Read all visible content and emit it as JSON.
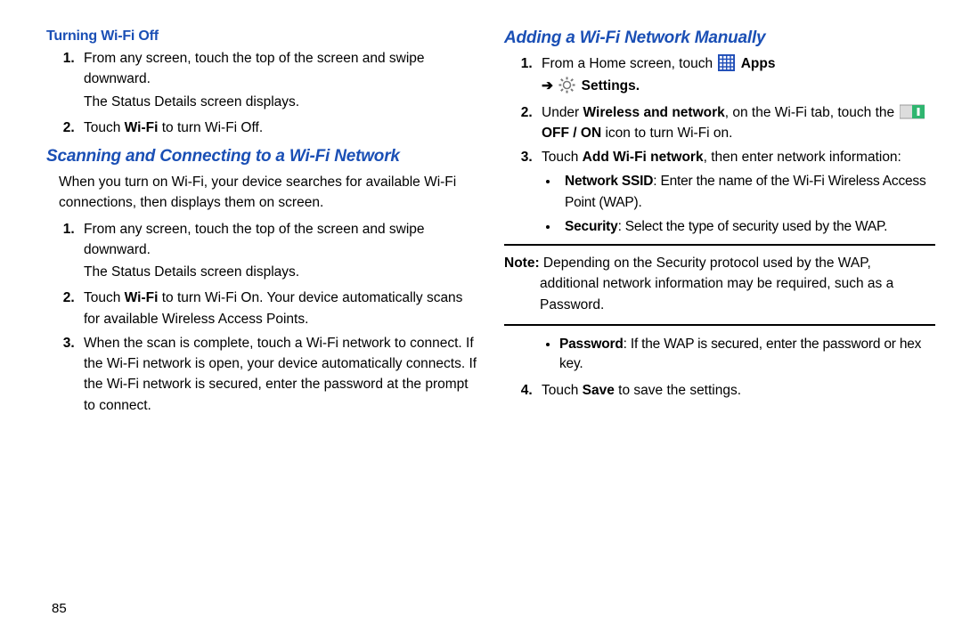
{
  "pageNumber": "85",
  "left": {
    "h1": "Turning Wi-Fi Off",
    "s1_num": "1.",
    "s1_a": "From any screen, touch the top of the screen and swipe downward.",
    "s1_b": "The Status Details screen displays.",
    "s2_num": "2.",
    "s2_a": "Touch ",
    "s2_b": "Wi-Fi",
    "s2_c": " to turn Wi-Fi Off.",
    "h2": "Scanning and Connecting to a Wi-Fi Network",
    "intro": "When you turn on Wi-Fi, your device searches for available Wi-Fi connections, then displays them on screen.",
    "s3_num": "1.",
    "s3_a": "From any screen, touch the top of the screen and swipe downward.",
    "s3_b": "The Status Details screen displays.",
    "s4_num": "2.",
    "s4_a": "Touch ",
    "s4_b": "Wi-Fi",
    "s4_c": " to turn Wi-Fi On. Your device automatically scans for available Wireless Access Points.",
    "s5_num": "3.",
    "s5_a": "When the scan is complete, touch a Wi-Fi network to connect. If the Wi-Fi network is open, your device automatically connects. If the Wi-Fi network is secured, enter the password at the prompt to connect."
  },
  "right": {
    "h1": "Adding a Wi-Fi Network Manually",
    "s1_num": "1.",
    "s1_a": "From a Home screen, touch ",
    "s1_apps": " Apps",
    "s1_arrow": "➔ ",
    "s1_settings": "Settings.",
    "s2_num": "2.",
    "s2_a": "Under ",
    "s2_b": "Wireless and network",
    "s2_c": ", on the Wi-Fi tab, touch the ",
    "s2_off": "OFF / ON",
    "s2_d": " icon to turn Wi-Fi on.",
    "s3_num": "3.",
    "s3_a": "Touch ",
    "s3_b": "Add Wi-Fi network",
    "s3_c": ", then enter network information:",
    "b1_a": "Network SSID",
    "b1_b": ": Enter the name of the Wi-Fi Wireless Access Point (WAP).",
    "b2_a": "Security",
    "b2_b": ": Select the type of security used by the WAP.",
    "note_label": "Note: ",
    "note_body": "Depending on the Security protocol used by the WAP, additional network information may be required, such as a Password.",
    "b3_a": "Password",
    "b3_b": ": If the WAP is secured, enter the password or hex key.",
    "s4_num": "4.",
    "s4_a": "Touch ",
    "s4_b": "Save",
    "s4_c": " to save the settings."
  }
}
